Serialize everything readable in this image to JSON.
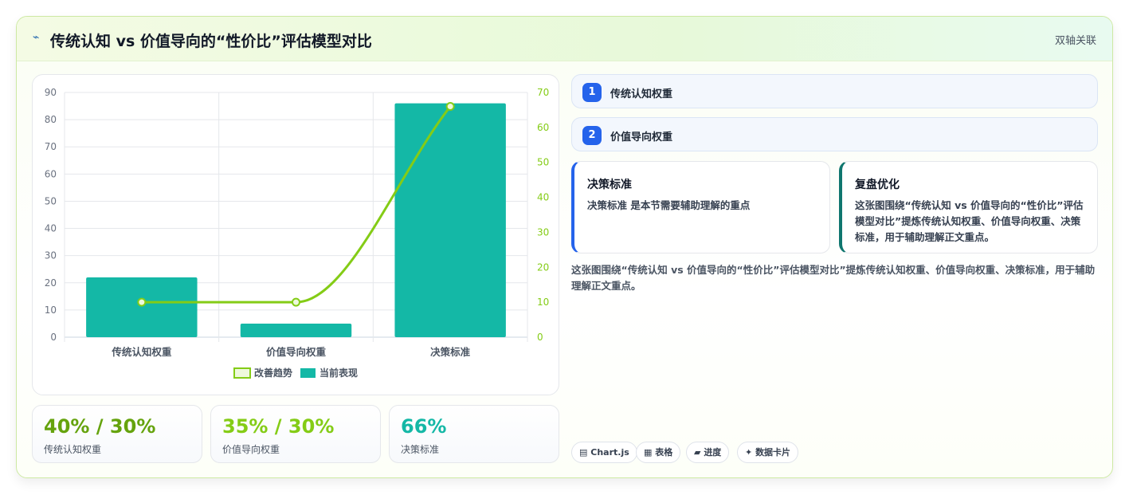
{
  "header": {
    "icon": "pulse-icon",
    "title": "传统认知 vs 价值导向的“性价比”评估模型对比",
    "tag": "双轴关联"
  },
  "chart_data": {
    "type": "bar",
    "categories": [
      "传统认知权重",
      "价值导向权重",
      "决策标准"
    ],
    "series": [
      {
        "name": "改善趋势",
        "type": "line",
        "axis": "right",
        "values": [
          10,
          10,
          66
        ],
        "color": "#84cc16"
      },
      {
        "name": "当前表现",
        "type": "bar",
        "axis": "left",
        "values": [
          22,
          5,
          86
        ],
        "color": "#14b8a6"
      }
    ],
    "y_left": {
      "min": 0,
      "max": 90,
      "ticks": [
        0,
        10,
        20,
        30,
        40,
        50,
        60,
        70,
        80,
        90
      ]
    },
    "y_right": {
      "min": 0,
      "max": 70,
      "ticks": [
        0,
        10,
        20,
        30,
        40,
        50,
        60,
        70
      ]
    },
    "grid": true,
    "legend": "bottom"
  },
  "stats": [
    {
      "value": "40% / 30%",
      "label": "传统认知权重",
      "color": "#65a30d"
    },
    {
      "value": "35% / 30%",
      "label": "价值导向权重",
      "color": "#84cc16"
    },
    {
      "value": "66%",
      "label": "决策标准",
      "color": "#14b8a6"
    }
  ],
  "steps": [
    {
      "num": "1",
      "label": "传统认知权重"
    },
    {
      "num": "2",
      "label": "价值导向权重"
    }
  ],
  "notes": [
    {
      "title": "决策标准",
      "body": "决策标准 是本节需要辅助理解的重点",
      "accent": "#2563eb"
    },
    {
      "title": "复盘优化",
      "body": "这张图围绕“传统认知 vs 价值导向的“性价比”评估模型对比”提炼传统认知权重、价值导向权重、决策标准，用于辅助理解正文重点。",
      "accent": "#0f766e"
    }
  ],
  "summary": "这张图围绕“传统认知 vs 价值导向的“性价比”评估模型对比”提炼传统认知权重、价值导向权重、决策标准，用于辅助理解正文重点。",
  "tags": [
    {
      "icon": "chart-icon",
      "glyph": "▤",
      "label": "Chart.js"
    },
    {
      "icon": "table-icon",
      "glyph": "▦",
      "label": "表格"
    },
    {
      "icon": "progress-icon",
      "glyph": "▰",
      "label": "进度"
    },
    {
      "icon": "sparkle-icon",
      "glyph": "✦",
      "label": "数据卡片"
    }
  ]
}
